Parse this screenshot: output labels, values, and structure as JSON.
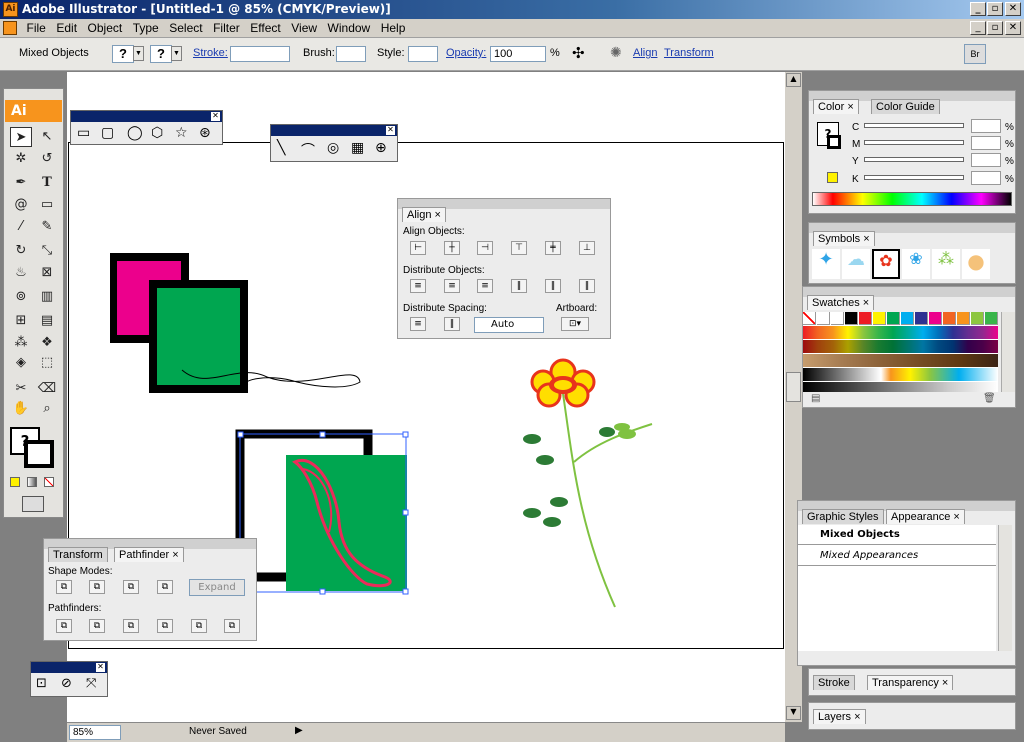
{
  "window": {
    "title": "Adobe Illustrator - [Untitled-1 @ 85% (CMYK/Preview)]",
    "app_icon": "Ai"
  },
  "menu": [
    "File",
    "Edit",
    "Object",
    "Type",
    "Select",
    "Filter",
    "Effect",
    "View",
    "Window",
    "Help"
  ],
  "control": {
    "selection": "Mixed Objects",
    "fill": "?",
    "stroke_q": "?",
    "stroke_label": "Stroke:",
    "brush_label": "Brush:",
    "style_label": "Style:",
    "opacity_label": "Opacity:",
    "opacity_value": "100",
    "percent": "%",
    "align": "Align",
    "transform": "Transform",
    "bridge": "Br"
  },
  "toolbox": {
    "badge": "Ai",
    "fill_q": "?"
  },
  "align_panel": {
    "tab": "Align",
    "align_objects": "Align Objects:",
    "distribute_objects": "Distribute Objects:",
    "distribute_spacing": "Distribute Spacing:",
    "artboard": "Artboard:",
    "auto": "Auto"
  },
  "pathfinder_panel": {
    "tab_transform": "Transform",
    "tab_pathfinder": "Pathfinder",
    "shape_modes": "Shape Modes:",
    "expand": "Expand",
    "pathfinders": "Pathfinders:"
  },
  "color_panel": {
    "tab_color": "Color",
    "tab_guide": "Color Guide",
    "channels": [
      "C",
      "M",
      "Y",
      "K"
    ],
    "percent": "%"
  },
  "symbols_panel": {
    "tab": "Symbols"
  },
  "swatches_panel": {
    "tab": "Swatches"
  },
  "appearance_panel": {
    "tab_styles": "Graphic Styles",
    "tab_appearance": "Appearance",
    "row1": "Mixed Objects",
    "row2": "Mixed Appearances"
  },
  "stroke_panel": {
    "tab_stroke": "Stroke",
    "tab_transparency": "Transparency"
  },
  "layers_panel": {
    "tab": "Layers"
  },
  "status": {
    "zoom": "85%",
    "message": "Never Saved"
  },
  "colors": {
    "accent": "#f7941d",
    "green": "#00a650",
    "magenta": "#ec008c",
    "title_bar": "#0a246a"
  }
}
